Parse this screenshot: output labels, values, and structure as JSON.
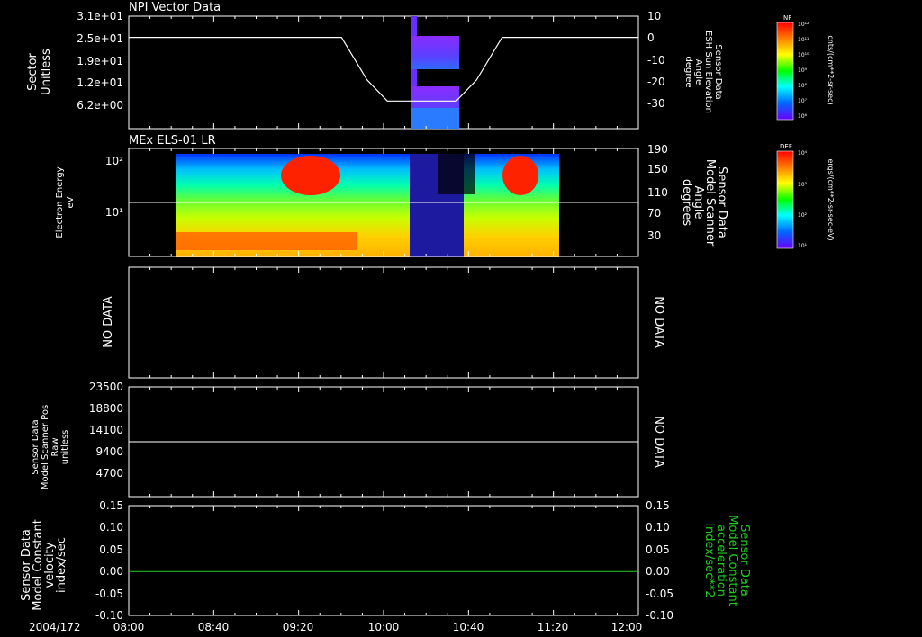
{
  "colors": {
    "background": "#000000",
    "axis": "#ffffff",
    "green_trace": "#22cc22",
    "cb_top": "#ff0000",
    "cb_bottom": "#6a00ff"
  },
  "chart_data": [
    {
      "type": "heatmap",
      "id": "panel1",
      "title": "NPI Vector Data",
      "ylabel": [
        "Sector",
        "Unitless"
      ],
      "yticks": [
        "3.1e+01",
        "2.5e+01",
        "1.9e+01",
        "1.2e+01",
        "6.2e+00"
      ],
      "y2label": [
        "Sensor Data",
        "ESH Sun Elevation",
        "Angle",
        "degree"
      ],
      "y2ticks": [
        "10",
        "0",
        "-10",
        "-20",
        "-30"
      ],
      "y2lim": [
        -43,
        10
      ],
      "colorbar": {
        "label": "NF",
        "unit": "cnts/(cm**2-sr-sec)",
        "ticks": [
          "10¹²",
          "10¹¹",
          "10¹⁰",
          "10⁹",
          "10⁸",
          "10⁷",
          "10⁶"
        ]
      },
      "overlay_line": {
        "x": [
          8.0,
          9.67,
          9.87,
          10.03,
          10.57,
          10.73,
          10.93,
          12.0
        ],
        "y": [
          0,
          0,
          -20,
          -30,
          -30,
          -20,
          0,
          0
        ]
      },
      "data_interval": [
        10.1,
        10.47
      ]
    },
    {
      "type": "heatmap",
      "id": "panel2",
      "title": "MEx ELS-01 LR",
      "ylabel": [
        "Electron Energy",
        "eV"
      ],
      "yticks": [
        "10²",
        "10¹"
      ],
      "y2label": [
        "Sensor Data",
        "Model Scanner",
        "Angle",
        "degrees"
      ],
      "y2ticks": [
        "190",
        "150",
        "110",
        "70",
        "30"
      ],
      "y2lim": [
        0,
        190
      ],
      "colorbar": {
        "label": "DEF",
        "unit": "ergs/(cm**2-sr-sec-eV)",
        "ticks": [
          "10⁴",
          "10³",
          "10²",
          "10¹"
        ]
      },
      "overlay_line": {
        "x": [
          8.0,
          12.0
        ],
        "y": [
          95,
          95
        ]
      },
      "data_interval": [
        8.85,
        11.4
      ]
    },
    {
      "type": "line",
      "id": "panel3",
      "left_note": "NO DATA",
      "right_note": "NO DATA"
    },
    {
      "type": "line",
      "id": "panel4",
      "ylabel": [
        "Sensor Data",
        "Model Scanner Pos",
        "Raw",
        "unitless"
      ],
      "yticks": [
        "23500",
        "18800",
        "14100",
        "9400",
        "4700"
      ],
      "ylim": [
        0,
        23500
      ],
      "right_note": "NO DATA",
      "series": [
        {
          "x": [
            8.0,
            12.0
          ],
          "values": [
            11750,
            11750
          ]
        }
      ]
    },
    {
      "type": "line",
      "id": "panel5",
      "ylabel": [
        "Sensor Data",
        "Model Constant",
        "velocity",
        "index/sec"
      ],
      "y2label": [
        "Sensor Data",
        "Model Constant",
        "acceleration",
        "index/sec**2"
      ],
      "yticks": [
        "0.15",
        "0.10",
        "0.05",
        "0.00",
        "-0.05",
        "-0.10"
      ],
      "ylim": [
        -0.1,
        0.15
      ],
      "series": [
        {
          "x": [
            8.0,
            12.0
          ],
          "values": [
            0.0,
            0.0
          ]
        }
      ]
    }
  ],
  "time_axis": {
    "date_label": "2004/172",
    "ticks": [
      "08:00",
      "08:40",
      "09:20",
      "10:00",
      "10:40",
      "11:20",
      "12:00"
    ],
    "range_hours": [
      8,
      12
    ]
  }
}
